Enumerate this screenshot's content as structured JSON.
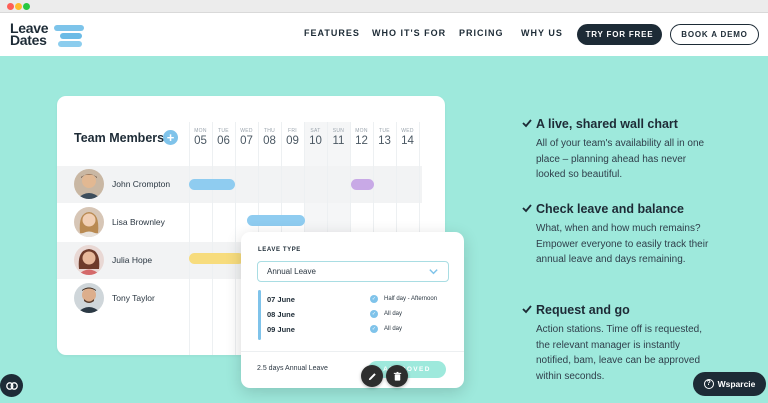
{
  "nav": {
    "logo_line1": "Leave",
    "logo_line2": "Dates",
    "links": [
      "FEATURES",
      "WHO IT'S FOR",
      "PRICING",
      "WHY US"
    ],
    "try_button": "TRY FOR FREE",
    "demo_button": "BOOK A DEMO"
  },
  "calendar": {
    "title": "Team Members",
    "days": [
      {
        "dow": "MON",
        "num": "05"
      },
      {
        "dow": "TUE",
        "num": "06"
      },
      {
        "dow": "WED",
        "num": "07"
      },
      {
        "dow": "THU",
        "num": "08"
      },
      {
        "dow": "FRI",
        "num": "09"
      },
      {
        "dow": "SAT",
        "num": "10"
      },
      {
        "dow": "SUN",
        "num": "11"
      },
      {
        "dow": "MON",
        "num": "12"
      },
      {
        "dow": "TUE",
        "num": "13"
      },
      {
        "dow": "WED",
        "num": "14"
      }
    ],
    "members": [
      "John Crompton",
      "Lisa Brownley",
      "Julia Hope",
      "Tony Taylor"
    ]
  },
  "popup": {
    "label": "LEAVE TYPE",
    "select_value": "Annual Leave",
    "entries": [
      {
        "date": "07 June",
        "type": "Half day - Afternoon"
      },
      {
        "date": "08 June",
        "type": "All day"
      },
      {
        "date": "09 June",
        "type": "All day"
      }
    ],
    "summary": "2.5 days Annual Leave",
    "status": "APPROVED"
  },
  "features": [
    {
      "title": "A live, shared wall chart",
      "desc": "All of your team's availability all in one place – planning ahead has never looked so beautiful."
    },
    {
      "title": "Check leave and balance",
      "desc": "What, when and how much remains? Empower everyone to easily track their annual leave and days remaining."
    },
    {
      "title": "Request and go",
      "desc": "Action stations. Time off is requested, the relevant manager is instantly notified, bam, leave can be approved within seconds."
    }
  ],
  "support_button": "Wsparcie",
  "colors": {
    "accent": "#9ee9dc",
    "dark": "#1d2b36",
    "blue": "#7fc3ea",
    "yellow": "#f7dc7d",
    "purple": "#c8a9e6"
  },
  "icons": [
    "calendar-icon",
    "plus-icon",
    "chevron-down-icon",
    "check-icon",
    "edit-icon",
    "trash-icon",
    "help-icon",
    "link-icon"
  ]
}
